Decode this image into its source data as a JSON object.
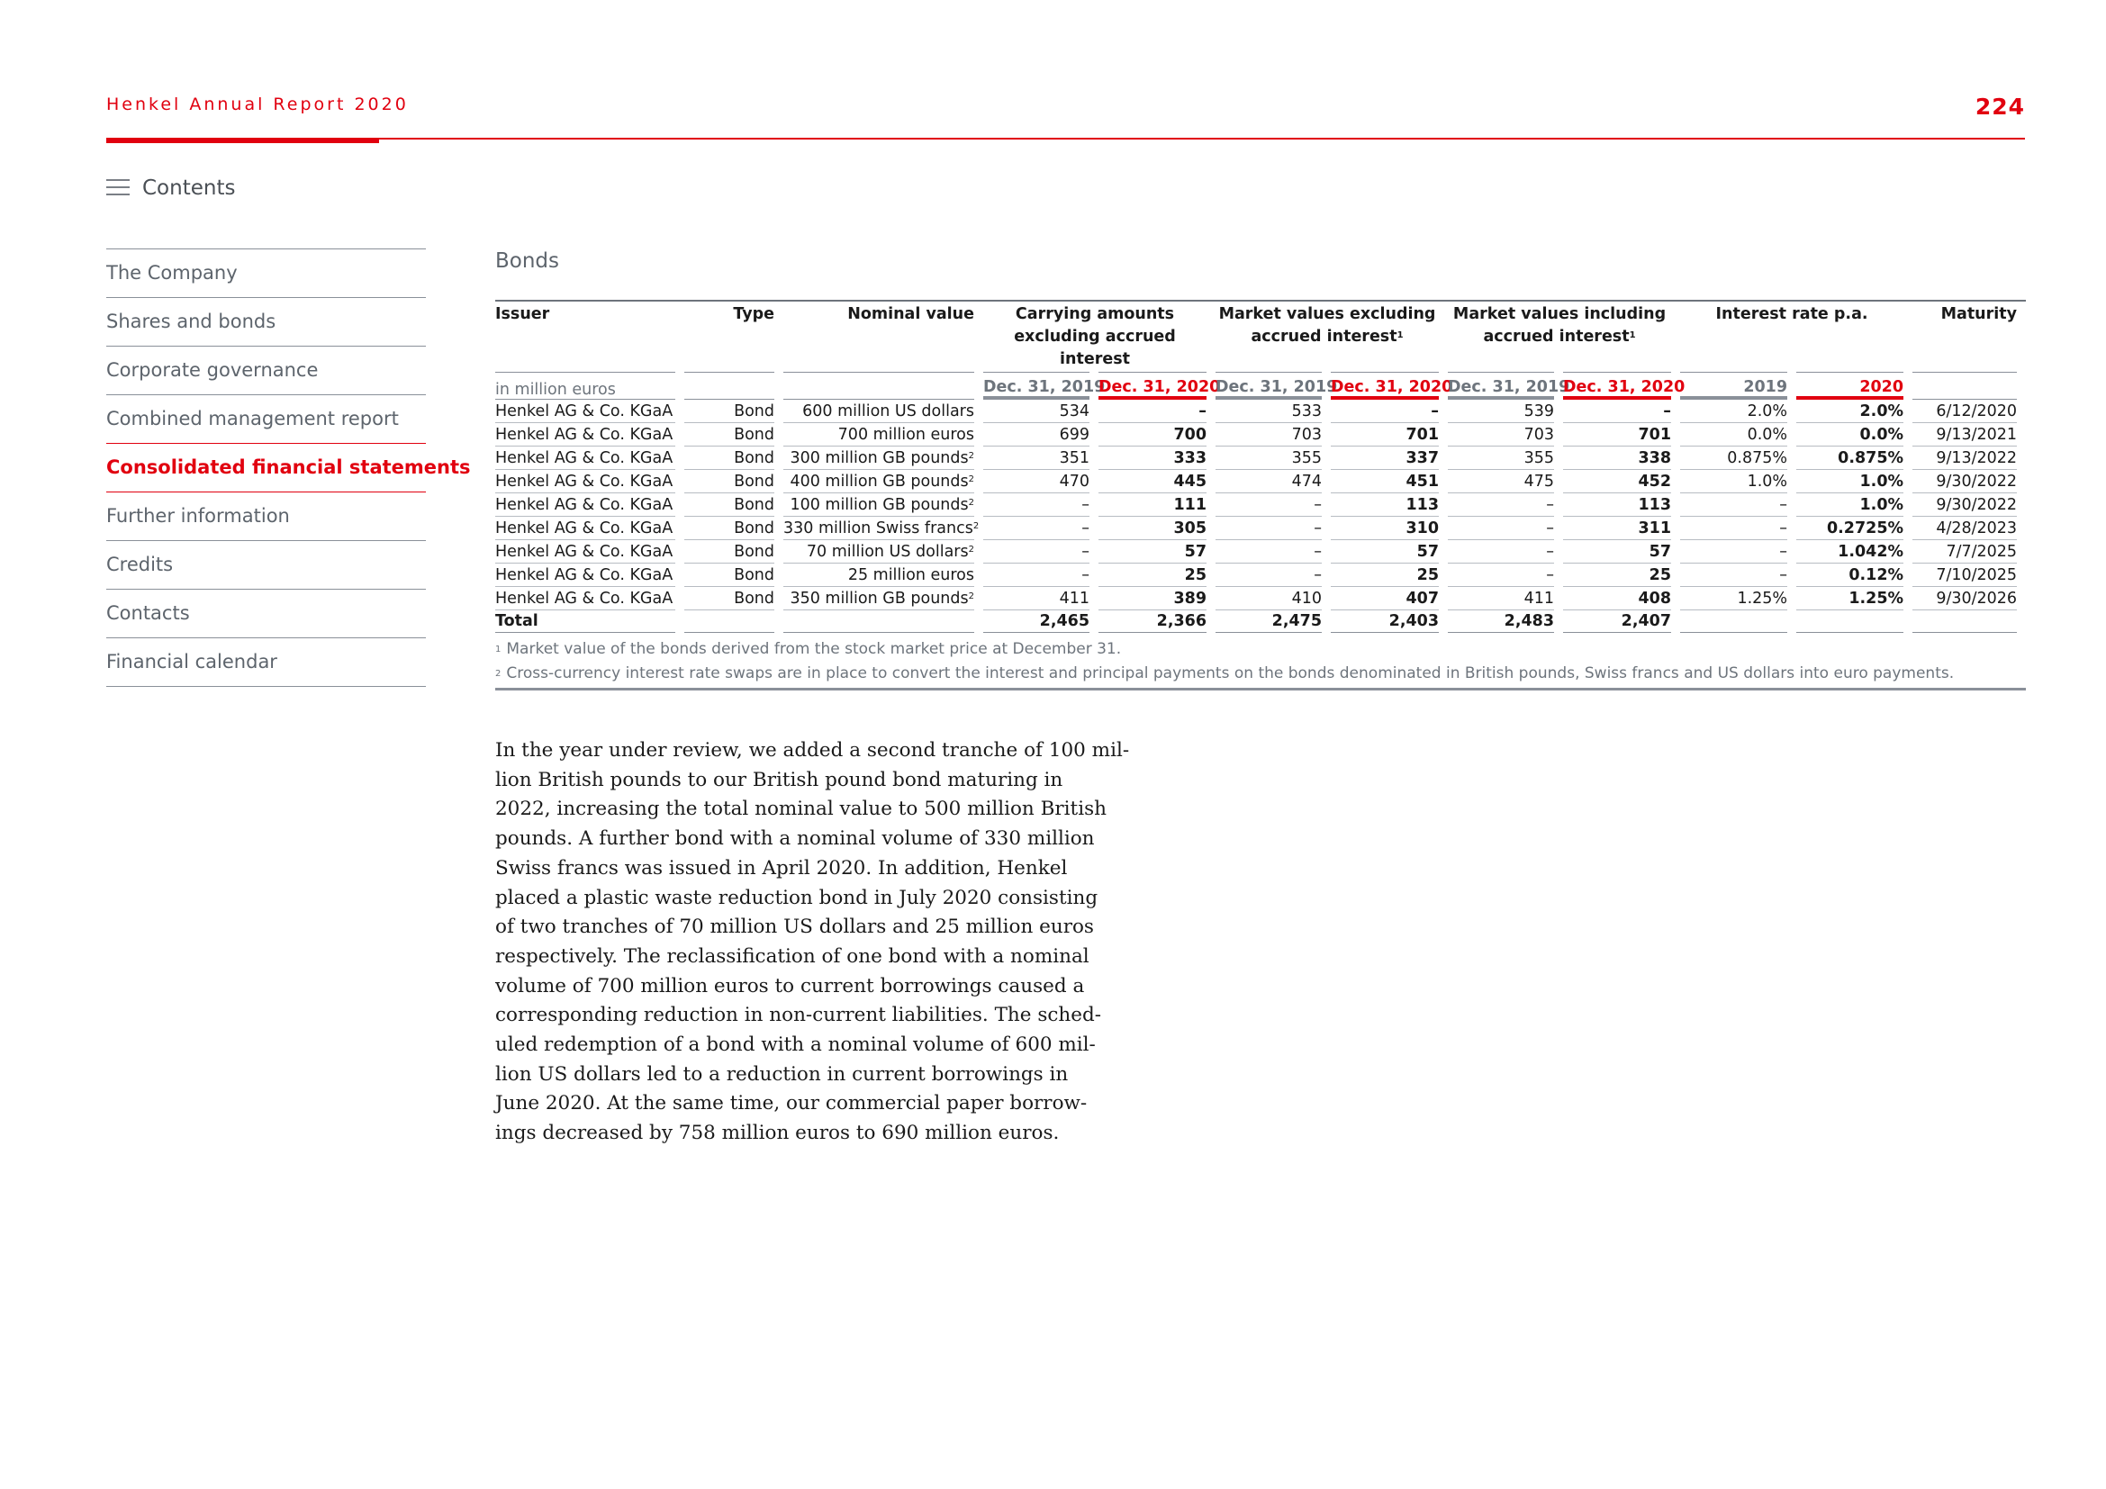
{
  "header": {
    "title": "Henkel Annual Report 2020",
    "page_number": "224"
  },
  "contents_label": "Contents",
  "sidebar": {
    "items": [
      {
        "label": "The Company"
      },
      {
        "label": "Shares and bonds"
      },
      {
        "label": "Corporate governance"
      },
      {
        "label": "Combined management report"
      },
      {
        "label": "Consolidated financial statements",
        "active": true
      },
      {
        "label": "Further information"
      },
      {
        "label": "Credits"
      },
      {
        "label": "Contacts"
      },
      {
        "label": "Financial calendar"
      }
    ]
  },
  "section_title": "Bonds",
  "table": {
    "headers": {
      "issuer": "Issuer",
      "type": "Type",
      "nominal": "Nominal value",
      "carrying": "Carrying amounts excluding accrued interest",
      "market_excl": "Market values excluding accrued interest",
      "market_incl": "Market values including accrued interest",
      "interest": "Interest rate p.a.",
      "maturity": "Maturity",
      "footnote_mark": "1"
    },
    "unit": "in million euros",
    "subheaders": {
      "d2019": "Dec. 31, 2019",
      "d2020": "Dec. 31, 2020",
      "y2019": "2019",
      "y2020": "2020"
    },
    "rows": [
      {
        "issuer": "Henkel AG & Co. KGaA",
        "type": "Bond",
        "nominal": "600 million US dollars",
        "fn": "",
        "c19": "534",
        "c20": "–",
        "me19": "533",
        "me20": "–",
        "mi19": "539",
        "mi20": "–",
        "r19": "2.0%",
        "r20": "2.0%",
        "maturity": "6/12/2020"
      },
      {
        "issuer": "Henkel AG & Co. KGaA",
        "type": "Bond",
        "nominal": "700 million euros",
        "fn": "",
        "c19": "699",
        "c20": "700",
        "me19": "703",
        "me20": "701",
        "mi19": "703",
        "mi20": "701",
        "r19": "0.0%",
        "r20": "0.0%",
        "maturity": "9/13/2021"
      },
      {
        "issuer": "Henkel AG & Co. KGaA",
        "type": "Bond",
        "nominal": "300 million GB pounds",
        "fn": "2",
        "c19": "351",
        "c20": "333",
        "me19": "355",
        "me20": "337",
        "mi19": "355",
        "mi20": "338",
        "r19": "0.875%",
        "r20": "0.875%",
        "maturity": "9/13/2022"
      },
      {
        "issuer": "Henkel AG & Co. KGaA",
        "type": "Bond",
        "nominal": "400 million GB pounds",
        "fn": "2",
        "c19": "470",
        "c20": "445",
        "me19": "474",
        "me20": "451",
        "mi19": "475",
        "mi20": "452",
        "r19": "1.0%",
        "r20": "1.0%",
        "maturity": "9/30/2022"
      },
      {
        "issuer": "Henkel AG & Co. KGaA",
        "type": "Bond",
        "nominal": "100 million GB pounds",
        "fn": "2",
        "c19": "–",
        "c20": "111",
        "me19": "–",
        "me20": "113",
        "mi19": "–",
        "mi20": "113",
        "r19": "–",
        "r20": "1.0%",
        "maturity": "9/30/2022"
      },
      {
        "issuer": "Henkel AG & Co. KGaA",
        "type": "Bond",
        "nominal": "330 million Swiss francs",
        "fn": "2",
        "c19": "–",
        "c20": "305",
        "me19": "–",
        "me20": "310",
        "mi19": "–",
        "mi20": "311",
        "r19": "–",
        "r20": "0.2725%",
        "maturity": "4/28/2023"
      },
      {
        "issuer": "Henkel AG & Co. KGaA",
        "type": "Bond",
        "nominal": "70 million US dollars",
        "fn": "2",
        "c19": "–",
        "c20": "57",
        "me19": "–",
        "me20": "57",
        "mi19": "–",
        "mi20": "57",
        "r19": "–",
        "r20": "1.042%",
        "maturity": "7/7/2025"
      },
      {
        "issuer": "Henkel AG & Co. KGaA",
        "type": "Bond",
        "nominal": "25 million euros",
        "fn": "",
        "c19": "–",
        "c20": "25",
        "me19": "–",
        "me20": "25",
        "mi19": "–",
        "mi20": "25",
        "r19": "–",
        "r20": "0.12%",
        "maturity": "7/10/2025"
      },
      {
        "issuer": "Henkel AG & Co. KGaA",
        "type": "Bond",
        "nominal": "350 million GB pounds",
        "fn": "2",
        "c19": "411",
        "c20": "389",
        "me19": "410",
        "me20": "407",
        "mi19": "411",
        "mi20": "408",
        "r19": "1.25%",
        "r20": "1.25%",
        "maturity": "9/30/2026"
      }
    ],
    "total": {
      "label": "Total",
      "c19": "2,465",
      "c20": "2,366",
      "me19": "2,475",
      "me20": "2,403",
      "mi19": "2,483",
      "mi20": "2,407"
    }
  },
  "footnotes": [
    {
      "mark": "1",
      "text": "Market value of the bonds derived from the stock market price at December 31."
    },
    {
      "mark": "2",
      "text": "Cross-currency interest rate swaps are in place to convert the interest and principal payments on the bonds denominated in British pounds, Swiss francs and US dollars into euro payments."
    }
  ],
  "body_lines": [
    "In the year under review, we added a second tranche of 100 mil-",
    "lion British pounds to our British pound bond maturing in",
    "2022, increasing the total nominal value to 500 million British",
    "pounds. A further bond with a nominal volume of 330 million",
    "Swiss francs was issued in April 2020. In addition, Henkel",
    "placed a plastic waste reduction bond in July 2020 consisting",
    "of two tranches of 70 million US dollars and 25 million euros",
    "respectively. The reclassification of one bond with a nominal",
    "volume of 700 million euros to current borrowings caused a",
    "corresponding reduction in non-current liabilities. The sched-",
    "uled redemption of a bond with a nominal volume of 600 mil-",
    "lion US dollars led to a reduction in current borrowings in",
    "June 2020. At the same time, our commercial paper borrow-",
    "ings decreased by 758 million euros to 690 million euros."
  ],
  "colors": {
    "accent": "#e1000f",
    "muted": "#5d646c",
    "rule": "#8a9099"
  }
}
